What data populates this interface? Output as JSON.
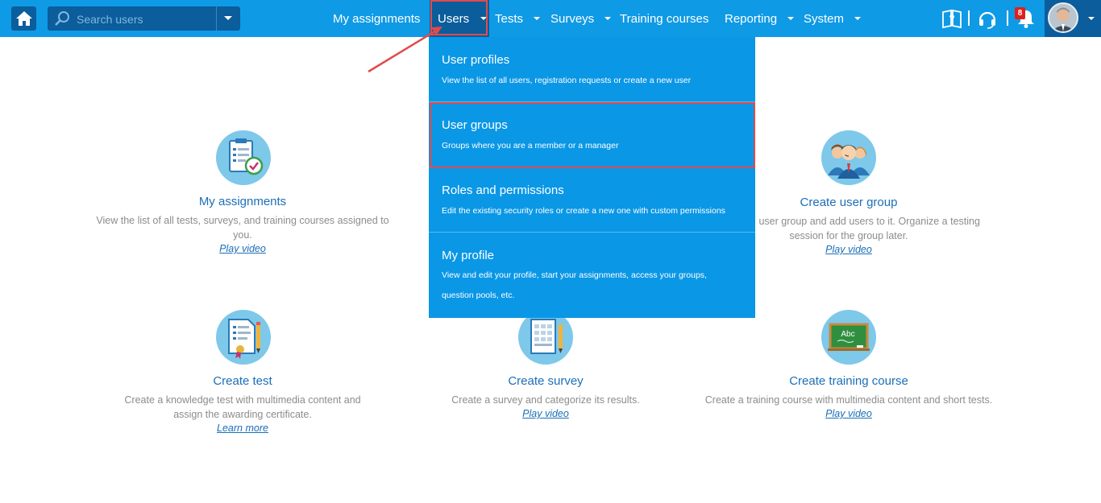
{
  "search": {
    "placeholder": "Search users"
  },
  "nav": {
    "items": [
      {
        "label": "My assignments"
      },
      {
        "label": "Users"
      },
      {
        "label": "Tests"
      },
      {
        "label": "Surveys"
      },
      {
        "label": "Training courses"
      },
      {
        "label": "Reporting"
      },
      {
        "label": "System"
      }
    ]
  },
  "notifications": {
    "count": "8"
  },
  "dropdown": {
    "items": [
      {
        "title": "User profiles",
        "description": "View the list of all users, registration requests or create a new user"
      },
      {
        "title": "User groups",
        "description": "Groups where you are a member or a manager"
      },
      {
        "title": "Roles and permissions",
        "description": "Edit the existing security roles or create a new one with custom permissions"
      },
      {
        "title": "My profile",
        "description": "View and edit your profile, start your assignments, access your groups, question pools, etc."
      }
    ]
  },
  "tiles": [
    {
      "title": "My assignments",
      "description": "View the list of all tests, surveys, and training courses assigned to you.",
      "link": "Play video"
    },
    {
      "title": "Create user group",
      "description": "Create a user group and add users to it. Organize a testing session for the group later.",
      "link": "Play video"
    },
    {
      "title": "Create test",
      "description": "Create a knowledge test with multimedia content and assign the awarding certificate.",
      "link": "Learn more"
    },
    {
      "title": "Create survey",
      "description": "Create a survey and categorize its results.",
      "link": "Play video"
    },
    {
      "title": "Create training course",
      "description": "Create a training course with multimedia content and short tests.",
      "link": "Play video"
    }
  ],
  "chalkboard": {
    "text": "Abc"
  },
  "colors": {
    "topbar": "#0f9ae6",
    "topbar_dark": "#0b5d9c",
    "dropdown": "#0a97e6",
    "highlight": "#e24a4a",
    "tile_title": "#1b6fb7",
    "tile_text": "#8c8c8c"
  }
}
